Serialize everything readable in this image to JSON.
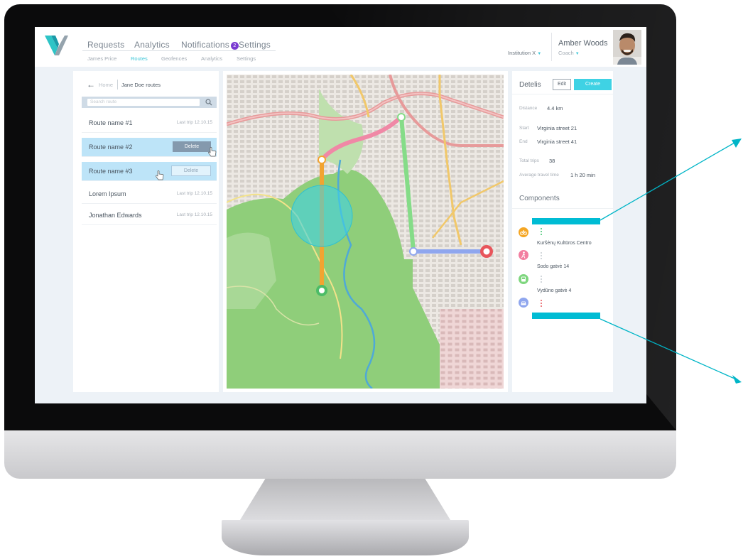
{
  "header": {
    "nav_main": [
      "Requests",
      "Analytics",
      "Notifications",
      "Settings"
    ],
    "notification_count": "2",
    "nav_sub": [
      "James Price",
      "Routes",
      "Geofences",
      "Analytics",
      "Settings"
    ],
    "institution": "Institution X",
    "user_name": "Amber Woods",
    "user_role": "Coach"
  },
  "routes_panel": {
    "back_label": "Home",
    "title": "Jane Doe routes",
    "search_placeholder": "Search route",
    "delete_label": "Delete",
    "routes": [
      {
        "name": "Route name #1",
        "meta": "Last trip 12.10.15"
      },
      {
        "name": "Route name #2",
        "meta": ""
      },
      {
        "name": "Route name #3",
        "meta": ""
      },
      {
        "name": "Lorem Ipsum",
        "meta": "Last trip 12.10.15"
      },
      {
        "name": "Jonathan Edwards",
        "meta": "Last trip 12.10.15"
      }
    ]
  },
  "details": {
    "title": "Detelis",
    "edit_label": "Edit",
    "create_label": "Create",
    "distance_label": "Distance",
    "distance_value": "4.4 km",
    "start_label": "Start",
    "start_value": "Virginia street 21",
    "end_label": "End",
    "end_value": "Virginia street 41",
    "trips_label": "Total trips",
    "trips_value": "38",
    "avg_label": "Average travel time",
    "avg_value": "1 h 20 min",
    "components_title": "Components",
    "stops": [
      "Kuršėnų Kultūros Centro",
      "Sodo gatvė 14",
      "Vydūno gatvė 4"
    ]
  },
  "colors": {
    "accent": "#3fd2e4",
    "annotation": "#00b5c7",
    "bike": "#f5a623",
    "walk": "#f27ea0",
    "bus": "#7ed67e",
    "car": "#8fa6ee"
  },
  "icons": {
    "bike": "bicycle-icon",
    "walk": "walking-icon",
    "bus": "bus-icon",
    "car": "car-icon"
  }
}
